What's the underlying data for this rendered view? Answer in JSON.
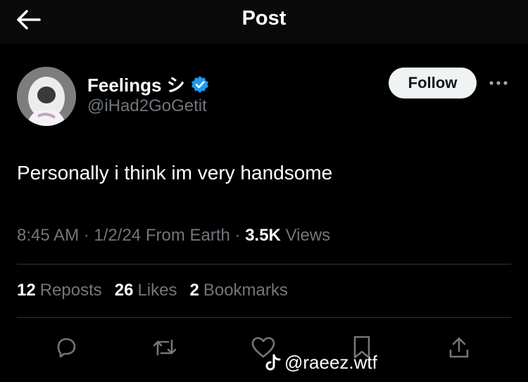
{
  "header": {
    "title": "Post"
  },
  "author": {
    "name": "Feelings シ",
    "handle": "@iHad2GoGetit",
    "verified": true,
    "follow_label": "Follow"
  },
  "post": {
    "text": "Personally i think im very handsome",
    "time": "8:45 AM",
    "date": "1/2/24",
    "source": "From Earth",
    "views_count": "3.5K",
    "views_label": "Views"
  },
  "stats": {
    "reposts_count": "12",
    "reposts_label": "Reposts",
    "likes_count": "26",
    "likes_label": "Likes",
    "bookmarks_count": "2",
    "bookmarks_label": "Bookmarks"
  },
  "watermark": {
    "text": "@raeez.wtf"
  },
  "colors": {
    "background": "#000000",
    "muted": "#71767b",
    "verified": "#1d9bf0",
    "divider": "#2f3336"
  },
  "icons": [
    "back-arrow-icon",
    "verified-badge-icon",
    "more-icon",
    "reply-icon",
    "repost-icon",
    "like-icon",
    "bookmark-icon",
    "share-icon",
    "tiktok-icon"
  ]
}
